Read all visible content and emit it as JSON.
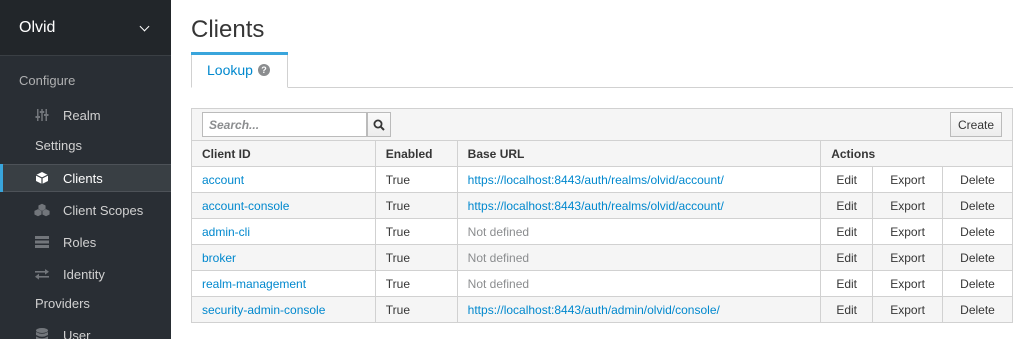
{
  "sidebar": {
    "realm": "Olvid",
    "section_configure": "Configure",
    "items": [
      {
        "label": "Realm",
        "label2": "Settings",
        "icon": "sliders-icon"
      },
      {
        "label": "Clients",
        "icon": "cube-icon",
        "active": true
      },
      {
        "label": "Client Scopes",
        "icon": "cubes-icon"
      },
      {
        "label": "Roles",
        "icon": "list-icon"
      },
      {
        "label": "Identity",
        "label2": "Providers",
        "icon": "exchange-icon"
      },
      {
        "label": "User",
        "icon": "database-icon"
      }
    ]
  },
  "main": {
    "title": "Clients",
    "tab_label": "Lookup",
    "search_placeholder": "Search...",
    "create_label": "Create",
    "columns": [
      "Client ID",
      "Enabled",
      "Base URL",
      "Actions"
    ],
    "actions": {
      "edit": "Edit",
      "export": "Export",
      "delete": "Delete"
    },
    "rows": [
      {
        "client_id": "account",
        "enabled": "True",
        "base_url": "https://localhost:8443/auth/realms/olvid/account/",
        "url_defined": true
      },
      {
        "client_id": "account-console",
        "enabled": "True",
        "base_url": "https://localhost:8443/auth/realms/olvid/account/",
        "url_defined": true
      },
      {
        "client_id": "admin-cli",
        "enabled": "True",
        "base_url": "Not defined",
        "url_defined": false
      },
      {
        "client_id": "broker",
        "enabled": "True",
        "base_url": "Not defined",
        "url_defined": false
      },
      {
        "client_id": "realm-management",
        "enabled": "True",
        "base_url": "Not defined",
        "url_defined": false
      },
      {
        "client_id": "security-admin-console",
        "enabled": "True",
        "base_url": "https://localhost:8443/auth/admin/olvid/console/",
        "url_defined": true
      }
    ]
  },
  "colors": {
    "sidebar_bg": "#292e34",
    "accent": "#39a5dc",
    "link": "#0088ce"
  }
}
